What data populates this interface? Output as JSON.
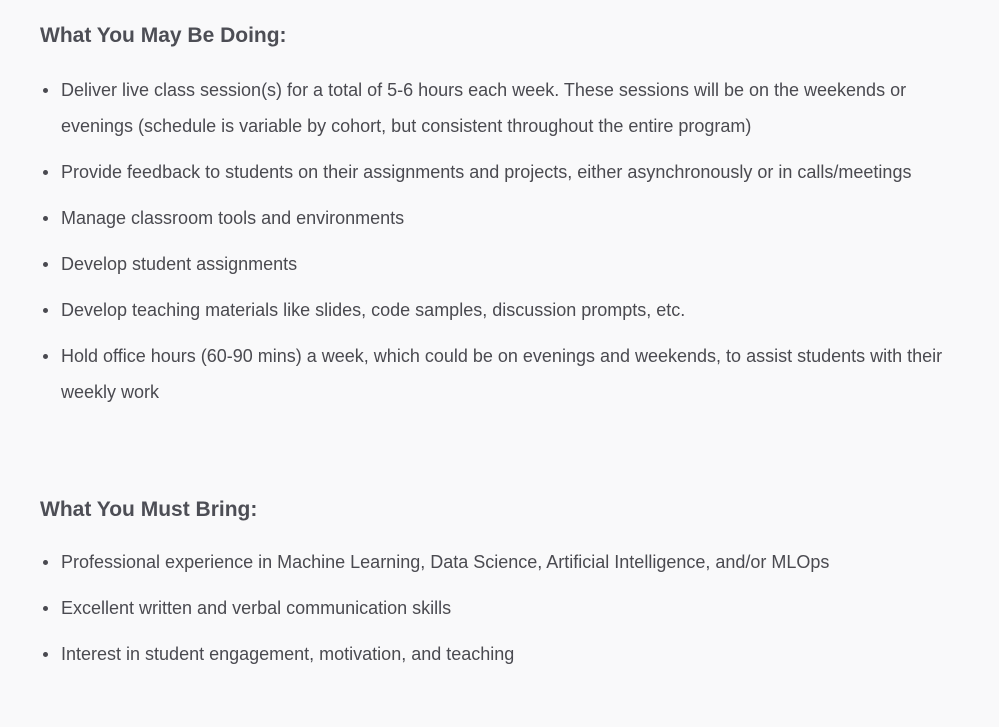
{
  "sections": [
    {
      "heading": "What You May Be Doing:",
      "items": [
        "Deliver live class session(s) for a total of 5-6 hours each week. These sessions will be on the weekends or evenings (schedule is variable by cohort, but consistent throughout the entire program)",
        "Provide feedback to students on their assignments and projects, either asynchronously or in calls/meetings",
        "Manage classroom tools and environments",
        "Develop student assignments",
        "Develop teaching materials like slides, code samples, discussion prompts, etc.",
        "Hold office hours (60-90 mins) a week, which could be on evenings and weekends, to assist students with their weekly work"
      ]
    },
    {
      "heading": "What You Must Bring:",
      "items": [
        "Professional experience in Machine Learning, Data Science, Artificial Intelligence, and/or MLOps",
        "Excellent written and verbal communication skills",
        "Interest in student engagement, motivation, and teaching"
      ]
    }
  ]
}
